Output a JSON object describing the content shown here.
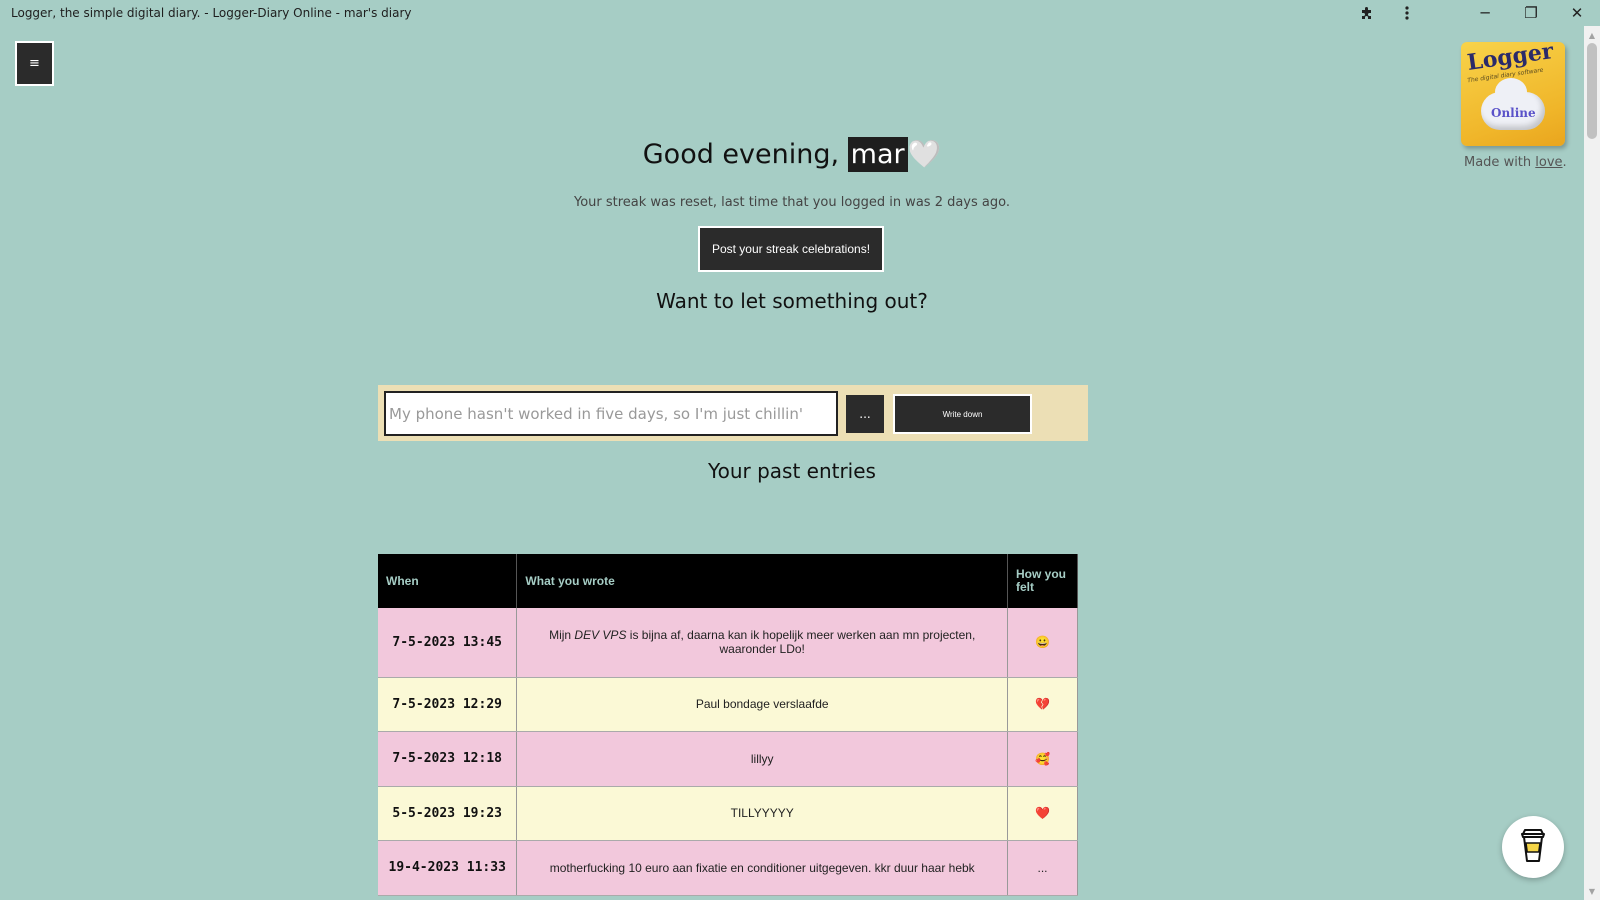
{
  "window": {
    "title": "Logger, the simple digital diary. - Logger-Diary Online - mar's diary",
    "extensions_icon": "puzzle-icon",
    "menu_icon": "kebab-menu-icon",
    "minimize_glyph": "─",
    "restore_glyph": "❐",
    "close_glyph": "✕"
  },
  "menu_button": {
    "glyph": "≡"
  },
  "logo": {
    "word": "Logger",
    "tagline": "The digital diary software",
    "cloud_word": "Online"
  },
  "made_with": {
    "prefix": "Made with ",
    "link": "love",
    "suffix": "."
  },
  "greeting": {
    "prefix": "Good evening, ",
    "name": "mar",
    "heart": "🤍"
  },
  "streak_message": "Your streak was reset, last time that you logged in was 2 days ago.",
  "streak_button": "Post your streak celebrations!",
  "prompt_heading": "Want to let something out?",
  "entry": {
    "placeholder": "My phone hasn't worked in five days, so I'm just chillin'",
    "emoji_button": "...",
    "write_button": "Write down"
  },
  "past_heading": "Your past entries",
  "table": {
    "headers": [
      "When",
      "What you wrote",
      "How you felt"
    ],
    "rows": [
      {
        "when": "7-5-2023 13:45",
        "wrote_pre": "Mijn ",
        "wrote_em": "DEV VPS",
        "wrote_post": " is bijna af, daarna kan ik hopelijk meer werken aan mn projecten, waaronder LDo!",
        "felt": "😀"
      },
      {
        "when": "7-5-2023 12:29",
        "wrote": "Paul bondage verslaafde",
        "felt": "💔"
      },
      {
        "when": "7-5-2023 12:18",
        "wrote": "lillyy",
        "felt": "🥰"
      },
      {
        "when": "5-5-2023 19:23",
        "wrote": "TILLYYYYY",
        "felt": "❤️"
      },
      {
        "when": "19-4-2023 11:33",
        "wrote": "motherfucking 10 euro aan fixatie en conditioner uitgegeven. kkr duur haar hebk",
        "felt": "..."
      }
    ]
  },
  "coffee_icon": "coffee-cup-icon",
  "colors": {
    "background": "#a6cdc5",
    "dark": "#2b2b2b",
    "row_pink": "#f2c8dc",
    "row_cream": "#fbf9d6",
    "entry_bar": "#ecdfb5"
  }
}
